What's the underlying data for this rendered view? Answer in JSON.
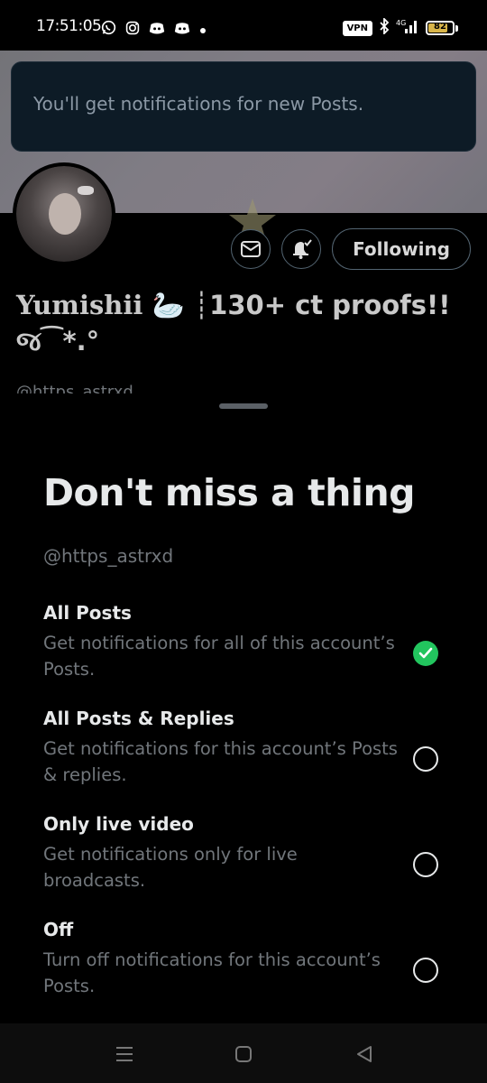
{
  "status_bar": {
    "time": "17:51:05",
    "app_icons": [
      "whatsapp-icon",
      "instagram-icon",
      "discord-icon",
      "discord-icon",
      "dot-icon"
    ],
    "vpn_label": "VPN",
    "network": "4G",
    "battery_level": "82",
    "battery_color": "#d8b54a"
  },
  "toast": {
    "message": "You'll get notifications for new Posts."
  },
  "profile": {
    "following_label": "Following",
    "display_name_serif": "Yumishii",
    "display_name_rest": " 🦢 ┊130+ ct proofs!!",
    "display_name_line2": "જ⁀*.°",
    "handle_peek": "@https_astrxd"
  },
  "sheet": {
    "title": "Don't miss a thing",
    "subtitle": "@https_astrxd",
    "options": [
      {
        "title": "All Posts",
        "description": "Get notifications for all of this account’s Posts.",
        "selected": true
      },
      {
        "title": "All Posts & Replies",
        "description": "Get notifications for this account’s Posts & replies.",
        "selected": false
      },
      {
        "title": "Only live video",
        "description": "Get notifications only for live broadcasts.",
        "selected": false
      },
      {
        "title": "Off",
        "description": "Turn off notifications for this account’s Posts.",
        "selected": false
      }
    ]
  },
  "colors": {
    "accent_check": "#22c55e",
    "muted_text": "#71767b",
    "toast_bg": "#0d1b26"
  },
  "nav_bar": {
    "icons": [
      "menu-icon",
      "home-square-icon",
      "back-triangle-icon"
    ]
  }
}
